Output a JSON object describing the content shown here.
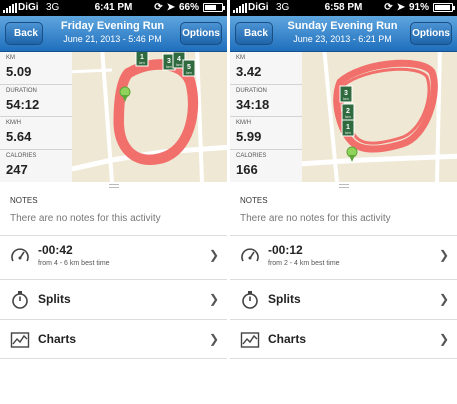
{
  "colors": {
    "route": "#f1706b",
    "nav": "#2b7fcb",
    "pin_green": "#2f6b3f"
  },
  "screens": [
    {
      "status": {
        "carrier": "DiGi",
        "network": "3G",
        "time": "6:41 PM",
        "battery": "66%",
        "battery_level": 0.66
      },
      "nav": {
        "back": "Back",
        "options": "Options",
        "title": "Friday Evening Run",
        "subtitle": "June 21, 2013 - 5:46 PM"
      },
      "stats": [
        {
          "label": "KM",
          "value": "5.09"
        },
        {
          "label": "DURATION",
          "value": "54:12"
        },
        {
          "label": "KM/H",
          "value": "5.64"
        },
        {
          "label": "CALORIES",
          "value": "247"
        }
      ],
      "markers": [
        "1",
        "3",
        "4",
        "5"
      ],
      "marker_unit": "km",
      "notes": {
        "heading": "NOTES",
        "text": "There are no notes for this activity"
      },
      "best": {
        "value": "-00:42",
        "detail": "from 4 - 6 km best time"
      },
      "splits": "Splits",
      "charts": "Charts"
    },
    {
      "status": {
        "carrier": "DiGi",
        "network": "3G",
        "time": "6:58 PM",
        "battery": "91%",
        "battery_level": 0.91
      },
      "nav": {
        "back": "Back",
        "options": "Options",
        "title": "Sunday Evening Run",
        "subtitle": "June 23, 2013 - 6:21 PM"
      },
      "stats": [
        {
          "label": "KM",
          "value": "3.42"
        },
        {
          "label": "DURATION",
          "value": "34:18"
        },
        {
          "label": "KM/H",
          "value": "5.99"
        },
        {
          "label": "CALORIES",
          "value": "166"
        }
      ],
      "markers": [
        "3",
        "2",
        "1"
      ],
      "marker_unit": "km",
      "notes": {
        "heading": "NOTES",
        "text": "There are no notes for this activity"
      },
      "best": {
        "value": "-00:12",
        "detail": "from 2 - 4 km best time"
      },
      "splits": "Splits",
      "charts": "Charts"
    }
  ]
}
